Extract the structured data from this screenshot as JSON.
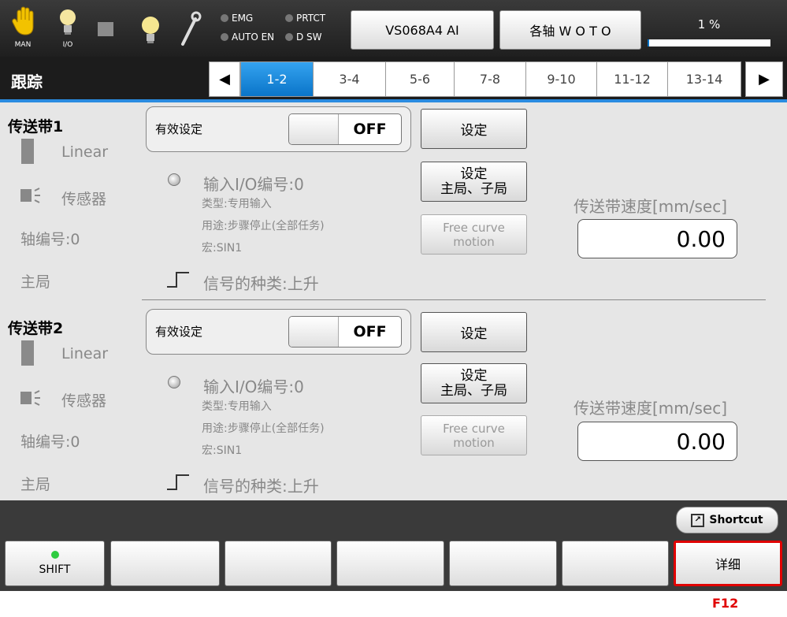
{
  "header": {
    "mode_label": "MAN",
    "io_label": "I/O",
    "indicators": [
      "EMG",
      "PRTCT",
      "AUTO EN",
      "D SW"
    ],
    "robot_button": "VS068A4 AI",
    "axis_button": "各轴 W O T O",
    "progress_text": "1 %",
    "progress_percent": 1
  },
  "title": "跟踪",
  "tabs": [
    "1-2",
    "3-4",
    "5-6",
    "7-8",
    "9-10",
    "11-12",
    "13-14"
  ],
  "active_tab": "1-2",
  "conveyors": [
    {
      "name": "传送带1",
      "type": "Linear",
      "sensor": "传感器",
      "axis": "轴编号:0",
      "role": "主局",
      "valid_label": "有效设定",
      "toggle": "OFF",
      "set_button": "设定",
      "master_button_line1": "设定",
      "master_button_line2": "主局、子局",
      "free_curve_line1": "Free curve",
      "free_curve_line2": "motion",
      "io_number": "输入I/O编号:0",
      "io_type": "类型:专用输入",
      "io_use": "用途:步骤停止(全部任务)",
      "io_macro": "宏:SIN1",
      "signal": "信号的种类:上升",
      "speed_label": "传送带速度[mm/sec]",
      "speed_value": "0.00"
    },
    {
      "name": "传送带2",
      "type": "Linear",
      "sensor": "传感器",
      "axis": "轴编号:0",
      "role": "主局",
      "valid_label": "有效设定",
      "toggle": "OFF",
      "set_button": "设定",
      "master_button_line1": "设定",
      "master_button_line2": "主局、子局",
      "free_curve_line1": "Free curve",
      "free_curve_line2": "motion",
      "io_number": "输入I/O编号:0",
      "io_type": "类型:专用输入",
      "io_use": "用途:步骤停止(全部任务)",
      "io_macro": "宏:SIN1",
      "signal": "信号的种类:上升",
      "speed_label": "传送带速度[mm/sec]",
      "speed_value": "0.00"
    }
  ],
  "shortcut_label": "Shortcut",
  "function_keys": [
    "SHIFT",
    "",
    "",
    "",
    "",
    "",
    "详细"
  ],
  "f12_caption": "F12",
  "colors": {
    "accent": "#0a74c8",
    "highlight": "#e00000",
    "shift_led": "#2ecc40"
  }
}
